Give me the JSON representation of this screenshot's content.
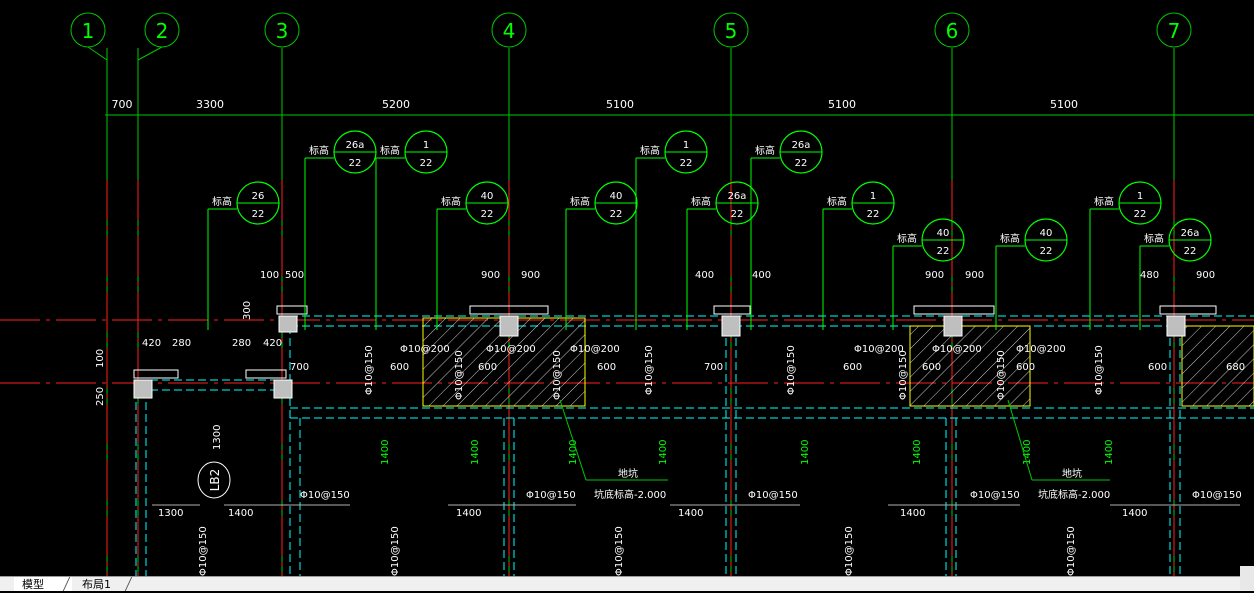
{
  "axes": [
    {
      "id": "axis-1",
      "label": "1"
    },
    {
      "id": "axis-2",
      "label": "2"
    },
    {
      "id": "axis-3",
      "label": "3"
    },
    {
      "id": "axis-4",
      "label": "4"
    },
    {
      "id": "axis-5",
      "label": "5"
    },
    {
      "id": "axis-6",
      "label": "6"
    },
    {
      "id": "axis-7",
      "label": "7"
    }
  ],
  "spacings": [
    "700",
    "3300",
    "5200",
    "5100",
    "5100",
    "5100"
  ],
  "beam_bubbles": [
    {
      "top": "26a",
      "bottom": "22",
      "prefix": "标高"
    },
    {
      "top": "1",
      "bottom": "22",
      "prefix": "标高"
    },
    {
      "top": "26",
      "bottom": "22",
      "prefix": "标高"
    },
    {
      "top": "40",
      "bottom": "22",
      "prefix": "标高"
    },
    {
      "top": "40",
      "bottom": "22",
      "prefix": "标高"
    },
    {
      "top": "1",
      "bottom": "22",
      "prefix": "标高"
    },
    {
      "top": "26a",
      "bottom": "22",
      "prefix": "标高"
    },
    {
      "top": "26a",
      "bottom": "22",
      "prefix": "标高"
    },
    {
      "top": "1",
      "bottom": "22",
      "prefix": "标高"
    },
    {
      "top": "40",
      "bottom": "22",
      "prefix": "标高"
    },
    {
      "top": "40",
      "bottom": "22",
      "prefix": "标高"
    },
    {
      "top": "1",
      "bottom": "22",
      "prefix": "标高"
    },
    {
      "top": "26a",
      "bottom": "22",
      "prefix": "标高"
    }
  ],
  "dims": {
    "d100": "100",
    "d500": "500",
    "d300": "300",
    "d900": "900",
    "d400": "400",
    "d420": "420",
    "d280": "280",
    "d250": "250",
    "d700": "700",
    "d600": "600",
    "d1300": "1300",
    "d1400": "1400",
    "d680": "680",
    "d480": "480"
  },
  "rebar": {
    "r200": "Φ10@200",
    "r150": "Φ10@150"
  },
  "notes": {
    "pit": "地坑",
    "pit_elev": "坑底标高-2.000",
    "slab_tag": "LB2"
  },
  "tabs": {
    "model": "模型",
    "layout1": "布局1"
  },
  "colors": {
    "background": "#000000",
    "grid_line": "#00c800",
    "axis_center": "#ff2020",
    "beam_outline": "#ffffff",
    "dashed_beam": "#00ffff",
    "dimension": "#ffffff",
    "hatch": "#ffff00",
    "text_green": "#00ff00"
  }
}
